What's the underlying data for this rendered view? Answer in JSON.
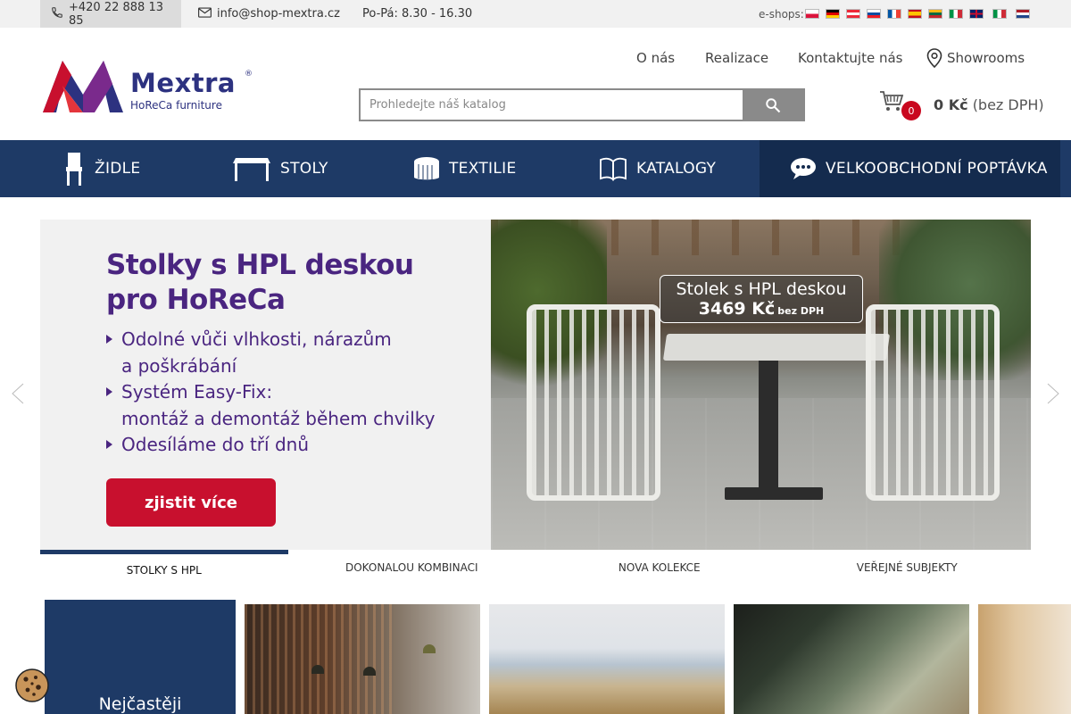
{
  "topbar": {
    "phone": "+420 22 888 13 85",
    "email": "info@shop-mextra.cz",
    "hours": "Po-Pá: 8.30 - 16.30",
    "eshops_label": "e-shops:",
    "flags": [
      "pl",
      "de",
      "at",
      "sk",
      "fr",
      "es",
      "lt",
      "it",
      "gb",
      "it",
      "nl"
    ]
  },
  "logo": {
    "brand": "Mextra",
    "registered": "®",
    "tagline": "HoReCa furniture"
  },
  "header": {
    "links": [
      "O nás",
      "Realizace",
      "Kontaktujte nás",
      "Showrooms"
    ],
    "search_placeholder": "Prohledejte náš katalog",
    "cart_count": "0",
    "cart_price": "0 Kč",
    "cart_price_note": "(bez DPH)"
  },
  "nav": {
    "items": [
      {
        "label": "ŽIDLE",
        "icon": "chair-icon"
      },
      {
        "label": "STOLY",
        "icon": "table-icon"
      },
      {
        "label": "TEXTILIE",
        "icon": "tablecloth-icon"
      },
      {
        "label": "KATALOGY",
        "icon": "book-icon"
      }
    ],
    "wholesale": {
      "label": "VELKOOBCHODNÍ POPTÁVKA",
      "icon": "chat-icon"
    }
  },
  "hero": {
    "headline_line1": "Stolky s HPL deskou",
    "headline_line2": "pro HoReCa",
    "bullets": [
      {
        "line1": "Odolné vůči vlhkosti, nárazům",
        "line2": "a poškrábání"
      },
      {
        "line1": "Systém Easy-Fix:",
        "line2": "montáž a demontáž během chvilky"
      },
      {
        "line1": "Odesíláme do tří dnů",
        "line2": ""
      }
    ],
    "cta": "zjistit více",
    "badge_title": "Stolek s HPL deskou",
    "badge_price": "3469 Kč",
    "badge_price_note": "bez DPH"
  },
  "slider_tabs": [
    {
      "label": "STOLKY S HPL",
      "active": true
    },
    {
      "label": "DOKONALOU KOMBINACI",
      "active": false
    },
    {
      "label": "NOVA KOLEKCE",
      "active": false
    },
    {
      "label": "VEŘEJNÉ SUBJEKTY",
      "active": false
    }
  ],
  "bottom": {
    "blue_card_text": "Nejčastěji"
  },
  "colors": {
    "navy": "#1e3a66",
    "purple": "#4a2580",
    "red": "#c8102e"
  }
}
